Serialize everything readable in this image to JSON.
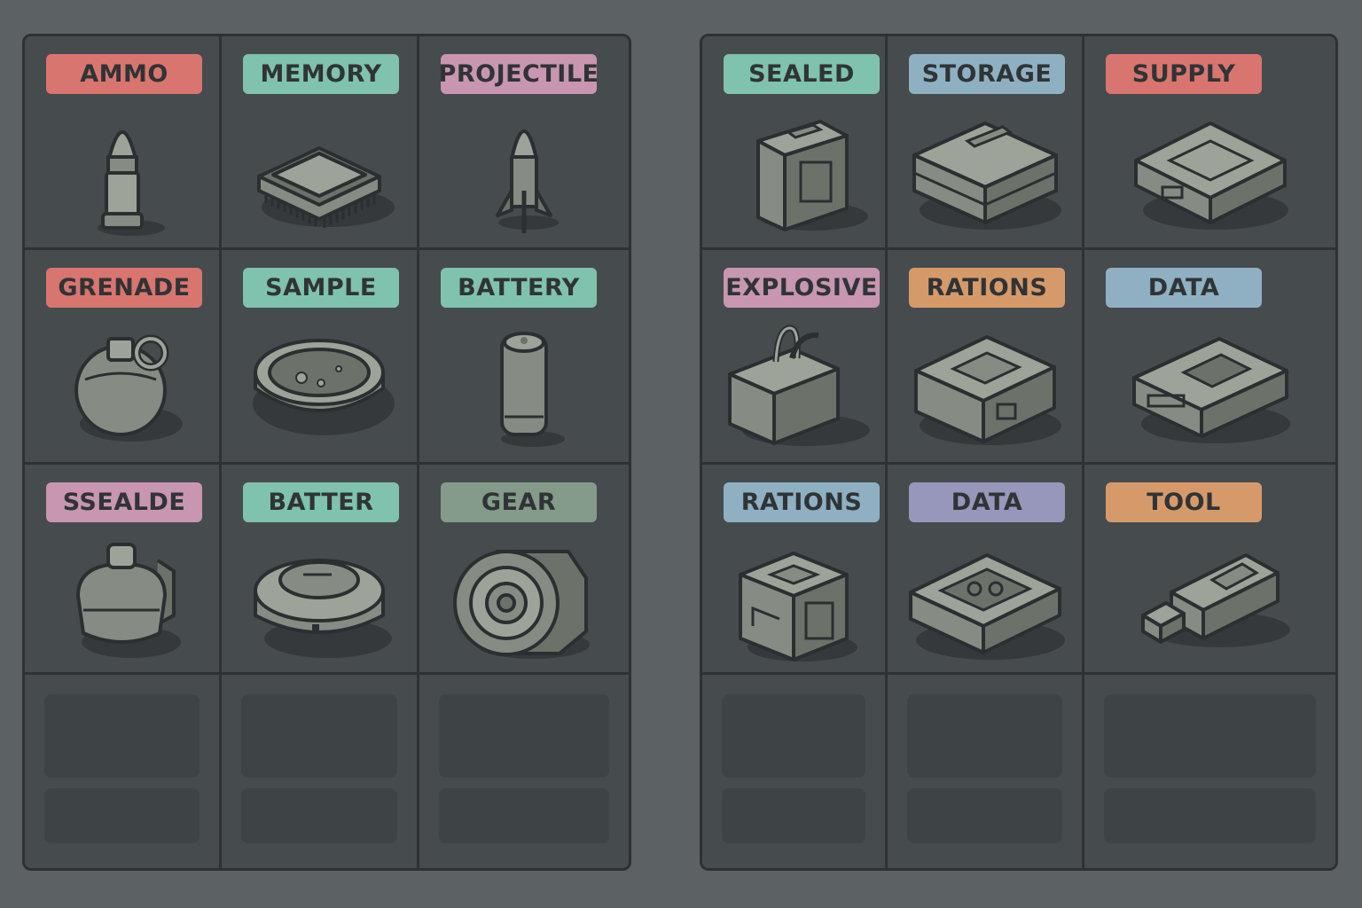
{
  "colors": {
    "red": "#d9756f",
    "teal": "#7fc2ae",
    "pink": "#c896b0",
    "sage": "#849b8a",
    "blue": "#8fb0c2",
    "orange": "#d69a6a",
    "purple": "#9697ba"
  },
  "left_panel": {
    "cells": [
      {
        "label": "AMMO",
        "color": "#d9756f",
        "icon": "bullet-icon"
      },
      {
        "label": "MEMORY",
        "color": "#7fc2ae",
        "icon": "chip-icon"
      },
      {
        "label": "PROJECTILE",
        "color": "#c896b0",
        "icon": "rocket-icon"
      },
      {
        "label": "GRENADE",
        "color": "#d9756f",
        "icon": "grenade-icon"
      },
      {
        "label": "SAMPLE",
        "color": "#7fc2ae",
        "icon": "petri-dish-icon"
      },
      {
        "label": "BATTERY",
        "color": "#7fc2ae",
        "icon": "battery-icon"
      },
      {
        "label": "SSEALDE",
        "color": "#c896b0",
        "icon": "canister-icon"
      },
      {
        "label": "BATTER",
        "color": "#7fc2ae",
        "icon": "mine-icon"
      },
      {
        "label": "GEAR",
        "color": "#849b8a",
        "icon": "lens-gear-icon"
      }
    ]
  },
  "right_panel": {
    "cells": [
      {
        "label": "SEALED",
        "color": "#7fc2ae",
        "icon": "sealed-crate-icon"
      },
      {
        "label": "STORAGE",
        "color": "#8fb0c2",
        "icon": "storage-crate-icon"
      },
      {
        "label": "SUPPLY",
        "color": "#d9756f",
        "icon": "supply-crate-icon"
      },
      {
        "label": "EXPLOSIVE",
        "color": "#c896b0",
        "icon": "explosive-box-icon"
      },
      {
        "label": "RATIONS",
        "color": "#d69a6a",
        "icon": "rations-crate-icon"
      },
      {
        "label": "DATA",
        "color": "#8fb0c2",
        "icon": "data-case-icon"
      },
      {
        "label": "RATIONS",
        "color": "#8fb0c2",
        "icon": "ration-cube-icon"
      },
      {
        "label": "DATA",
        "color": "#9697ba",
        "icon": "tape-case-icon"
      },
      {
        "label": "TOOL",
        "color": "#d69a6a",
        "icon": "usb-tool-icon"
      }
    ]
  }
}
